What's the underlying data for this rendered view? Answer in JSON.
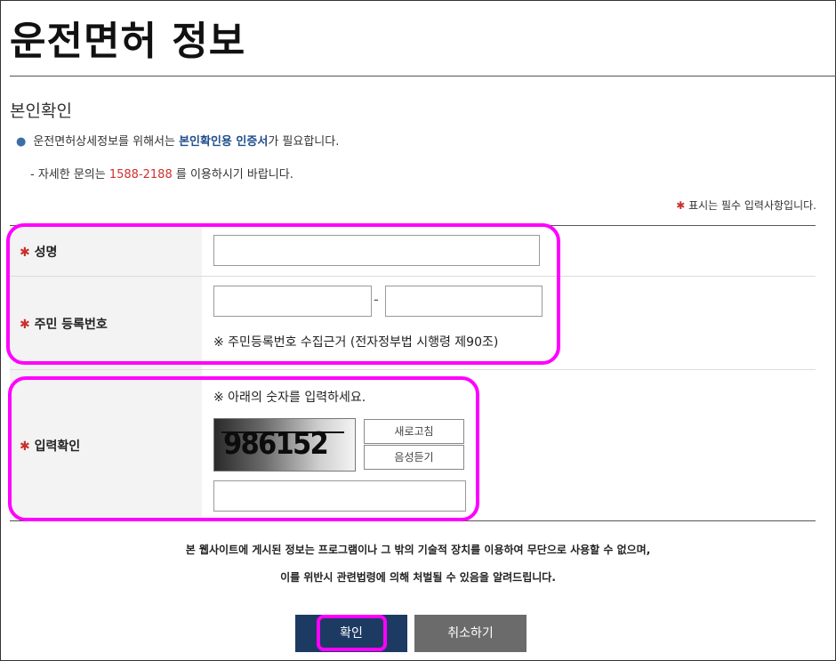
{
  "page": {
    "title": "운전면허 정보",
    "section_title": "본인확인"
  },
  "notice": {
    "line1_prefix": "운전면허상세정보를 위해서는 ",
    "line1_highlight": "본인확인용 인증서",
    "line1_suffix": "가 필요합니다.",
    "line2_prefix": "- 자세한 문의는 ",
    "line2_phone": "1588-2188",
    "line2_suffix": " 를 이용하시기 바랍니다.",
    "required_mark": "✱",
    "required_note": " 표시는 필수 입력사항입니다."
  },
  "form": {
    "name_label": "성명",
    "name_value": "",
    "ssn_label": "주민 등록번호",
    "ssn_front_value": "",
    "ssn_back_value": "",
    "ssn_dash": "-",
    "ssn_note": "※ 주민등록번호 수집근거 (전자정부법 시행령 제90조)",
    "captcha_label": "입력확인",
    "captcha_note": "※ 아래의 숫자를 입력하세요.",
    "captcha_code": "986152",
    "refresh_label": "새로고침",
    "audio_label": "음성듣기",
    "captcha_value": ""
  },
  "disclaimer": {
    "line1": "본 웹사이트에 게시된 정보는 프로그램이나 그 밖의 기술적 장치를 이용하여 무단으로 사용할 수 없으며,",
    "line2": "이를 위반시 관련법령에 의해 처벌될 수 있음을 알려드립니다."
  },
  "buttons": {
    "confirm": "확인",
    "cancel": "취소하기"
  },
  "colors": {
    "highlight": "#ff00ff",
    "confirm_bg": "#1d3a63",
    "cancel_bg": "#6b6b6b",
    "accent_blue": "#1f4f8c",
    "accent_red": "#d0302c"
  }
}
